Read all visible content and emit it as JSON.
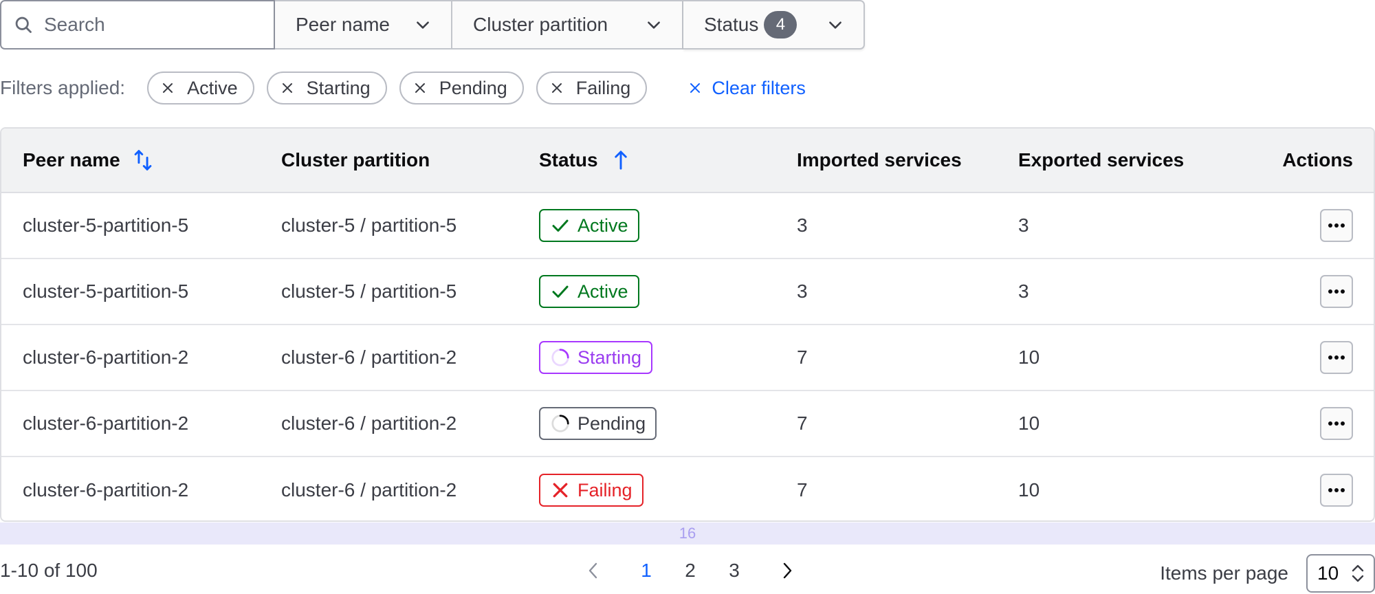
{
  "filterbar": {
    "search_placeholder": "Search",
    "dropdowns": [
      {
        "label": "Peer name"
      },
      {
        "label": "Cluster partition"
      },
      {
        "label": "Status",
        "count": "4"
      }
    ]
  },
  "applied_filters": {
    "label": "Filters applied:",
    "chips": [
      "Active",
      "Starting",
      "Pending",
      "Failing"
    ],
    "clear_label": "Clear filters"
  },
  "table": {
    "headers": [
      "Peer name",
      "Cluster partition",
      "Status",
      "Imported services",
      "Exported services",
      "Actions"
    ],
    "rows": [
      {
        "peer": "cluster-5-partition-5",
        "partition": "cluster-5 / partition-5",
        "status": "Active",
        "imported": "3",
        "exported": "3"
      },
      {
        "peer": "cluster-5-partition-5",
        "partition": "cluster-5 / partition-5",
        "status": "Active",
        "imported": "3",
        "exported": "3"
      },
      {
        "peer": "cluster-6-partition-2",
        "partition": "cluster-6 / partition-2",
        "status": "Starting",
        "imported": "7",
        "exported": "10"
      },
      {
        "peer": "cluster-6-partition-2",
        "partition": "cluster-6 / partition-2",
        "status": "Pending",
        "imported": "7",
        "exported": "10"
      },
      {
        "peer": "cluster-6-partition-2",
        "partition": "cluster-6 / partition-2",
        "status": "Failing",
        "imported": "7",
        "exported": "10"
      }
    ]
  },
  "overlay_band": {
    "label": "16"
  },
  "pagination": {
    "total_label": "1-10 of 100",
    "pages": [
      "1",
      "2",
      "3"
    ],
    "current_page": "1",
    "items_per_page_label": "Items per page",
    "items_per_page_value": "10"
  },
  "colors": {
    "accent": "#1060ff",
    "active": "#00781e",
    "starting": "#a737ff",
    "pending": "#656a76",
    "failing": "#e52228"
  }
}
